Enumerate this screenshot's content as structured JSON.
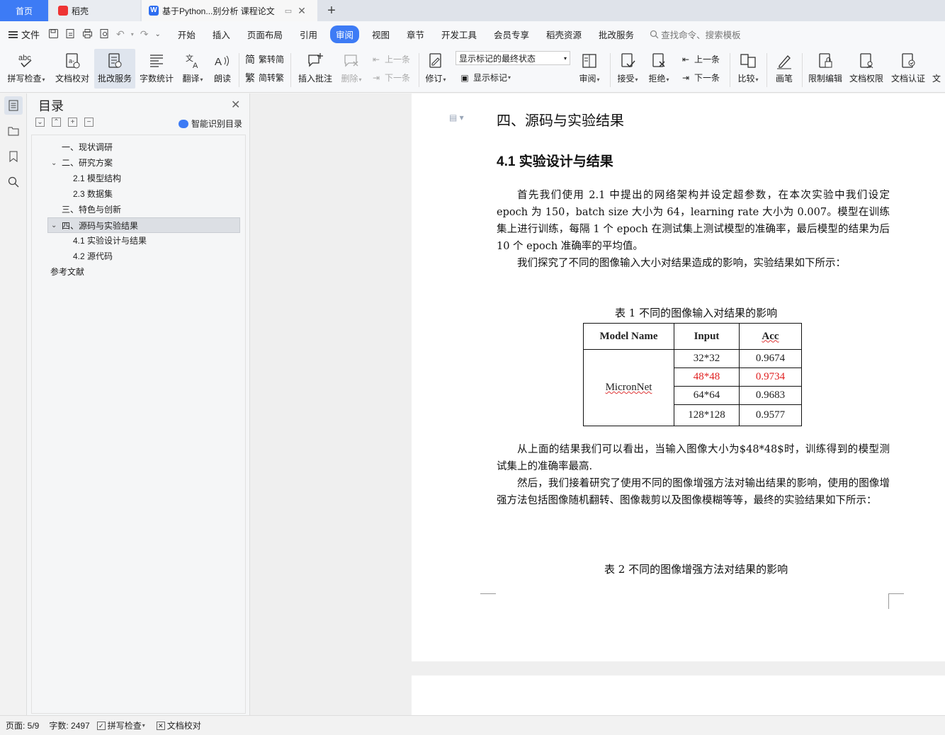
{
  "tabs": {
    "home": "首页",
    "daoke": "稻壳",
    "doc": "基于Python...别分析 课程论文",
    "add": "+"
  },
  "menu": {
    "file": "文件",
    "items": [
      "开始",
      "插入",
      "页面布局",
      "引用",
      "审阅",
      "视图",
      "章节",
      "开发工具",
      "会员专享",
      "稻壳资源",
      "批改服务"
    ],
    "active": "审阅",
    "search": "查找命令、搜索模板"
  },
  "ribbon": {
    "spell": "拼写检查",
    "proof": "文档校对",
    "review_service": "批改服务",
    "wordcount": "字数统计",
    "translate": "翻译",
    "read": "朗读",
    "trad_to_simp": "繁转简",
    "simp_to_trad": "简转繁",
    "insert_comment": "插入批注",
    "delete": "删除",
    "prev": "上一条",
    "next": "下一条",
    "revise": "修订",
    "markup_state": "显示标记的最终状态",
    "show_markup": "显示标记",
    "review": "审阅",
    "accept": "接受",
    "reject": "拒绝",
    "prev2": "上一条",
    "next2": "下一条",
    "compare": "比较",
    "pen": "画笔",
    "restrict": "限制编辑",
    "permission": "文档权限",
    "certify": "文档认证",
    "more": "文"
  },
  "toc": {
    "title": "目录",
    "smart": "智能识别目录",
    "items": [
      {
        "label": "一、现状调研"
      },
      {
        "label": "二、研究方案"
      },
      {
        "label": "2.1  模型结构"
      },
      {
        "label": "2.3  数据集"
      },
      {
        "label": "三、特色与创新"
      },
      {
        "label": "四、源码与实验结果"
      },
      {
        "label": "4.1  实验设计与结果"
      },
      {
        "label": "4.2  源代码"
      },
      {
        "label": "参考文献"
      }
    ]
  },
  "document": {
    "heading1": "四、源码与实验结果",
    "heading2": "4.1  实验设计与结果",
    "para1": "首先我们使用 2.1 中提出的网络架构并设定超参数，在本次实验中我们设定 epoch 为 150，batch size 大小为 64，learning rate 大小为 0.007。模型在训练集上进行训练，每隔 1 个 epoch 在测试集上测试模型的准确率，最后模型的结果为后 10 个 epoch 准确率的平均值。",
    "para2": "我们探究了不同的图像输入大小对结果造成的影响，实验结果如下所示：",
    "table1_caption": "表 1  不同的图像输入对结果的影响",
    "table1": {
      "headers": [
        "Model Name",
        "Input",
        "Acc"
      ],
      "model": "MicronNet",
      "rows": [
        {
          "input": "32*32",
          "acc": "0.9674"
        },
        {
          "input": "48*48",
          "acc": "0.9734"
        },
        {
          "input": "64*64",
          "acc": "0.9683"
        },
        {
          "input": "128*128",
          "acc": "0.9577"
        }
      ],
      "highlight_color": "#e02020"
    },
    "para3": "从上面的结果我们可以看出，当输入图像大小为$48*48$时，训练得到的模型测试集上的准确率最高.",
    "para4": "然后，我们接着研究了使用不同的图像增强方法对输出结果的影响，使用的图像增强方法包括图像随机翻转、图像裁剪以及图像模糊等等，最终的实验结果如下所示：",
    "table2_caption": "表 2  不同的图像增强方法对结果的影响"
  },
  "status": {
    "page": "页面: 5/9",
    "words": "字数: 2497",
    "spell": "拼写检查",
    "proof": "文档校对"
  },
  "colors": {
    "accent": "#3d7bf5",
    "highlight": "#e02020"
  }
}
